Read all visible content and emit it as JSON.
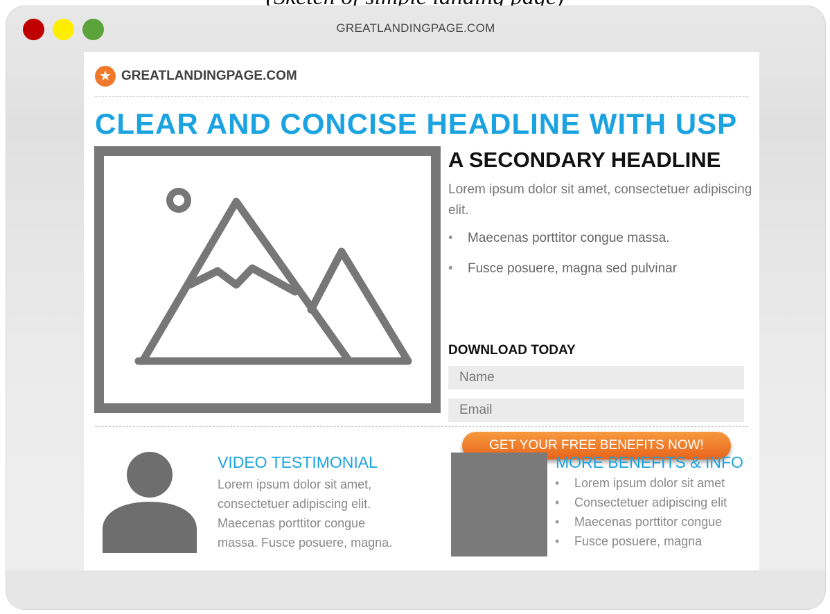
{
  "caption": "(Sketch of simple landing page)",
  "window": {
    "url": "GREATLANDINGPAGE.COM",
    "controls": {
      "close": "#c00000",
      "minimize": "#ffee00",
      "maximize": "#5aa23a"
    }
  },
  "brand": {
    "logo_icon": "star-icon",
    "name": "GREATLANDINGPAGE.COM",
    "logo_color": "#f0782a"
  },
  "hero": {
    "headline": "CLEAR AND CONCISE HEADLINE WITH USP",
    "headline_color": "#1aa3e0",
    "image_icon": "mountain-image-placeholder-icon",
    "secondary_headline": "A SECONDARY HEADLINE",
    "intro": "Lorem ipsum dolor sit amet, consectetuer adipiscing elit.",
    "bullets": [
      "Maecenas porttitor congue massa.",
      "Fusce posuere, magna sed pulvinar"
    ]
  },
  "form": {
    "title": "DOWNLOAD TODAY",
    "name_placeholder": "Name",
    "email_placeholder": "Email",
    "cta_label": "GET YOUR FREE BENEFITS NOW!",
    "cta_color": "#f07b25"
  },
  "testimonial": {
    "avatar_icon": "person-avatar-icon",
    "title": "VIDEO TESTIMONIAL",
    "lines": [
      "Lorem ipsum dolor sit amet,",
      "consectetuer adipiscing elit.",
      "Maecenas porttitor congue",
      "massa. Fusce posuere, magna."
    ]
  },
  "benefits": {
    "title": "MORE BENEFITS & INFO",
    "items": [
      "Lorem ipsum dolor sit amet",
      "Consectetuer adipiscing elit",
      "Maecenas porttitor congue",
      "Fusce posuere, magna"
    ]
  }
}
